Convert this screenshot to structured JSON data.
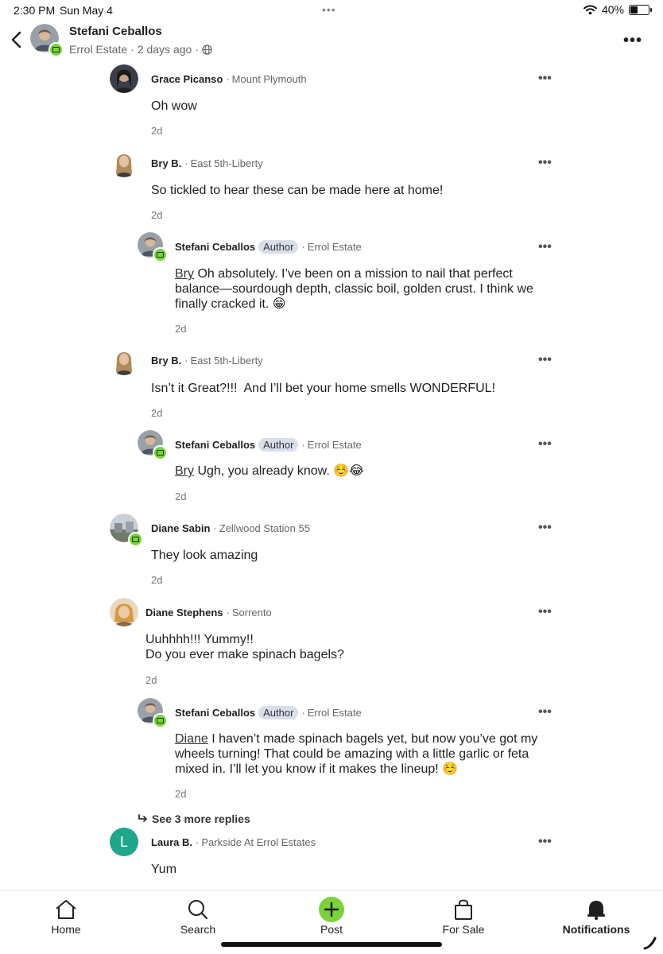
{
  "status_bar": {
    "time": "2:30 PM",
    "date": "Sun May 4",
    "battery": "40%",
    "battery_level": 0.4
  },
  "header": {
    "name": "Stefani Ceballos",
    "neighborhood": "Errol Estate",
    "posted": "2 days ago",
    "more_icon": "more-horizontal-icon"
  },
  "comments": [
    {
      "name": "Grace Picanso",
      "place": "Mount Plymouth",
      "text": "Oh wow",
      "time": "2d"
    },
    {
      "name": "Bry B.",
      "place": "East 5th-Liberty",
      "text": "So tickled to hear these can be made here at home!",
      "time": "2d"
    },
    {
      "name": "Stefani Ceballos",
      "badge": "Author",
      "place": "Errol Estate",
      "mention": "Bry",
      "text": "Oh absolutely. I’ve been on a mission to nail that perfect balance—sourdough depth, classic boil, golden crust. I think we finally cracked it. 😁",
      "time": "2d"
    },
    {
      "name": "Bry B.",
      "place": "East 5th-Liberty",
      "text": "Isn’t it Great?!!!  And I’ll bet your home smells WONDERFUL!",
      "time": "2d"
    },
    {
      "name": "Stefani Ceballos",
      "badge": "Author",
      "place": "Errol Estate",
      "mention": "Bry",
      "text": "Ugh, you already know. ☺️😂",
      "time": "2d"
    },
    {
      "name": "Diane Sabin",
      "place": "Zellwood Station 55",
      "text": "They look amazing",
      "time": "2d"
    },
    {
      "name": "Diane Stephens",
      "place": "Sorrento",
      "text_line1": "Uuhhhh!!! Yummy!!",
      "text_line2": "Do you ever make spinach bagels?",
      "time": "2d"
    },
    {
      "name": "Stefani Ceballos",
      "badge": "Author",
      "place": "Errol Estate",
      "mention": "Diane",
      "text": "I haven’t made spinach bagels yet, but now you’ve got my wheels turning! That could be amazing with a little garlic or feta mixed in. I’ll let you know if it makes the lineup! ☺️",
      "time": "2d"
    },
    {
      "name": "Laura B.",
      "place": "Parkside At Errol Estates",
      "initial": "L",
      "text": "Yum"
    }
  ],
  "see_more": "See 3 more replies",
  "separator": "·",
  "more_glyph": "•••",
  "nav": {
    "home": "Home",
    "search": "Search",
    "post": "Post",
    "for_sale": "For Sale",
    "notifications": "Notifications"
  },
  "colors": {
    "accent_green": "#7bd23a",
    "author_badge_bg": "#d8deea",
    "laura_avatar": "#1fa78c"
  }
}
